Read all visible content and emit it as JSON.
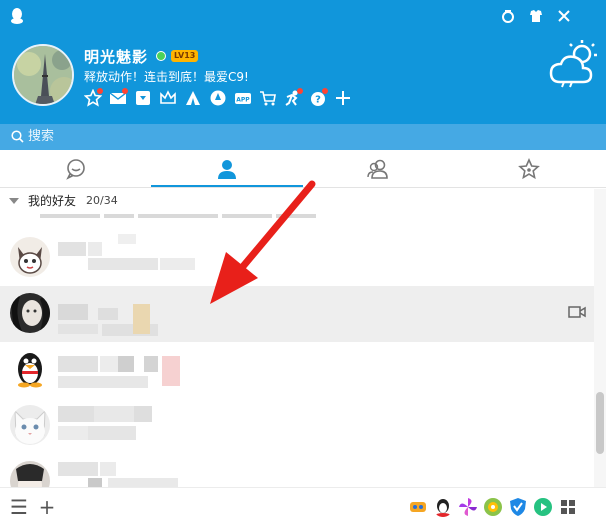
{
  "profile": {
    "nickname": "明光魅影",
    "level_badge": "LV13",
    "signature": "释放动作！连击到底！最爱C9!",
    "status": "online"
  },
  "window_controls": [
    "skin-icon",
    "shirt-icon",
    "close-icon"
  ],
  "app_icons": [
    "star-icon",
    "mail-icon",
    "calendar-icon",
    "crown-icon",
    "tent-icon",
    "browser-icon",
    "app-icon",
    "cart-icon",
    "game-icon",
    "badge-icon",
    "plus-icon"
  ],
  "search": {
    "label": "搜索"
  },
  "tabs": [
    {
      "name": "messages-tab",
      "icon": "chat-bubble-icon"
    },
    {
      "name": "contacts-tab",
      "icon": "person-icon",
      "active": true
    },
    {
      "name": "groups-tab",
      "icon": "group-icon"
    },
    {
      "name": "favorites-tab",
      "icon": "star-outline-icon"
    }
  ],
  "group": {
    "name": "我的好友",
    "count": "20/34"
  },
  "bottom": {
    "menu_label": "☰",
    "add_label": "+"
  },
  "colors": {
    "accent": "#1196db",
    "search": "#45a9e4",
    "selected": "#eeeeee",
    "arrow": "#e8201a"
  }
}
